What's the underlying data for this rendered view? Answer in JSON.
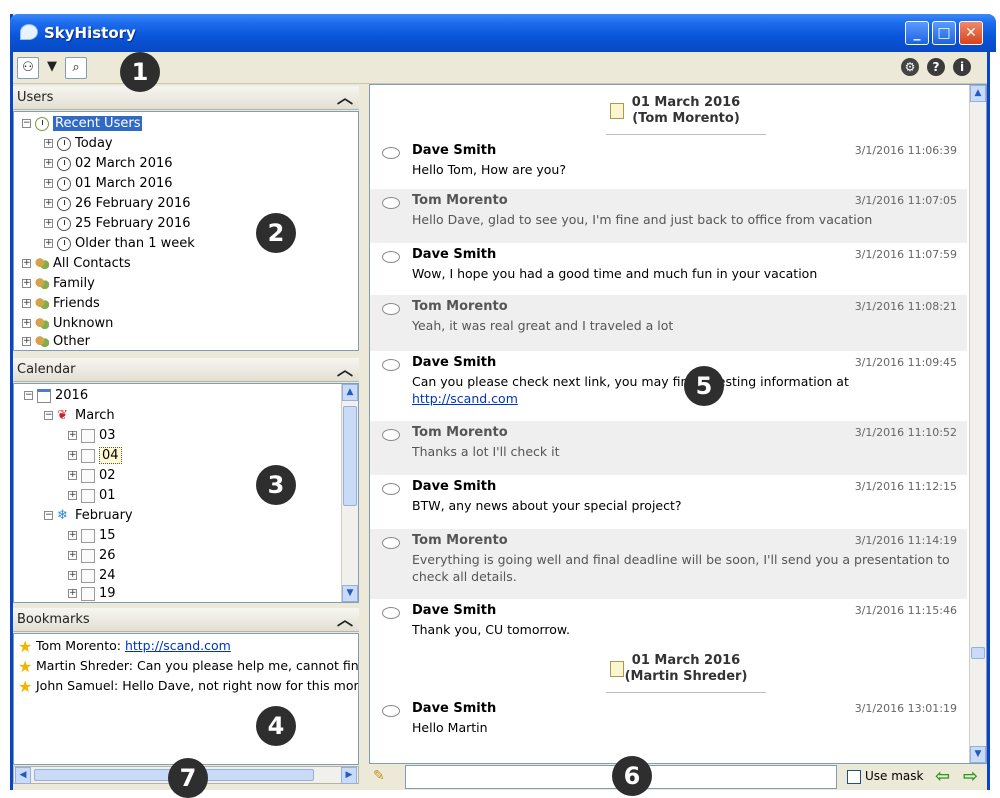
{
  "app": {
    "title": "SkyHistory"
  },
  "window_buttons": {
    "minimize": "_",
    "maximize": "□",
    "close": "✕"
  },
  "toolbar": {
    "left_icons": [
      "users-icon",
      "filter-icon",
      "search-icon"
    ],
    "right_icons": [
      "gear-icon",
      "help-icon",
      "info-icon"
    ]
  },
  "callouts": [
    "1",
    "2",
    "3",
    "4",
    "5",
    "6",
    "7"
  ],
  "users_panel": {
    "title": "Users",
    "root": "Recent Users",
    "recent": [
      "Today",
      "02 March 2016",
      "01 March 2016",
      "26 February 2016",
      "25 February 2016",
      "Older than 1 week"
    ],
    "groups": [
      "All Contacts",
      "Family",
      "Friends",
      "Unknown",
      "Other"
    ]
  },
  "calendar_panel": {
    "title": "Calendar",
    "year": "2016",
    "months": [
      {
        "name": "March",
        "days": [
          "03",
          "04",
          "02",
          "01"
        ]
      },
      {
        "name": "February",
        "days": [
          "15",
          "26",
          "24",
          "19"
        ]
      }
    ]
  },
  "bookmarks_panel": {
    "title": "Bookmarks",
    "items": [
      {
        "prefix": "Tom Morento: ",
        "link": "http://scand.com",
        "text": ""
      },
      {
        "prefix": "Martin Shreder: Can you please help me, cannot find",
        "link": "",
        "text": ""
      },
      {
        "prefix": "John Samuel: Hello Dave, not right now for this mom",
        "link": "",
        "text": ""
      }
    ]
  },
  "conversations": [
    {
      "date": "01 March 2016",
      "with": "(Tom Morento)"
    },
    {
      "date": "01 March 2016",
      "with": "(Martin Shreder)"
    }
  ],
  "messages": [
    {
      "author": "Dave Smith",
      "time": "3/1/2016 11:06:39",
      "text": "Hello Tom, How are you?",
      "link": ""
    },
    {
      "author": "Tom Morento",
      "time": "3/1/2016 11:07:05",
      "text": "Hello Dave, glad to see you, I'm fine and just back to office from vacation",
      "link": ""
    },
    {
      "author": "Dave Smith",
      "time": "3/1/2016 11:07:59",
      "text": "Wow, I hope  you had a good time and much fun in your vacation",
      "link": ""
    },
    {
      "author": "Tom Morento",
      "time": "3/1/2016 11:08:21",
      "text": "Yeah, it was real great and I traveled a lot",
      "link": ""
    },
    {
      "author": "Dave Smith",
      "time": "3/1/2016 11:09:45",
      "text": "Can you please check next link, you may find     teresting information at",
      "link": "http://scand.com"
    },
    {
      "author": "Tom Morento",
      "time": "3/1/2016 11:10:52",
      "text": "Thanks a lot I'll check it",
      "link": ""
    },
    {
      "author": "Dave Smith",
      "time": "3/1/2016 11:12:15",
      "text": "BTW, any news about your special project?",
      "link": ""
    },
    {
      "author": "Tom Morento",
      "time": "3/1/2016 11:14:19",
      "text": "Everything is going well and final deadline will be soon, I'll send you a presentation to check all details.",
      "link": ""
    },
    {
      "author": "Dave Smith",
      "time": "3/1/2016 11:15:46",
      "text": "Thank you, CU tomorrow.",
      "link": ""
    },
    {
      "author": "Dave Smith",
      "time": "3/1/2016 13:01:19",
      "text": "Hello Martin",
      "link": ""
    }
  ],
  "search_bar": {
    "input_value": "",
    "use_mask_label": "Use mask"
  }
}
